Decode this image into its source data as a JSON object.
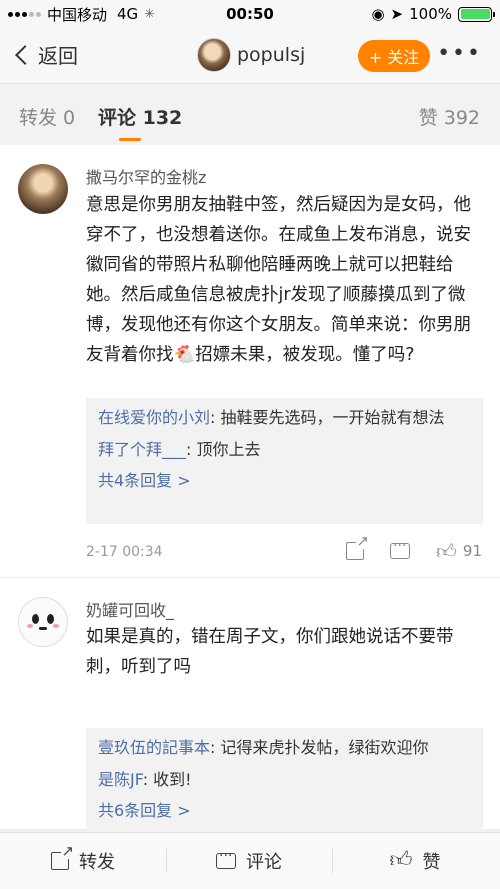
{
  "status": {
    "carrier": "中国移动",
    "network": "4G",
    "time": "00:50",
    "battery": "100%",
    "battery_level": 1.0
  },
  "nav": {
    "back_label": "返回",
    "username": "populsj",
    "follow_label": "+ 关注",
    "more": "•••"
  },
  "tabs": {
    "repost": "转发 0",
    "comments": "评论 132",
    "likes": "赞 392"
  },
  "comments": [
    {
      "user": "撒马尔罕的金桃z",
      "text": "意思是你男朋友抽鞋中签，然后疑因为是女码，他穿不了，也没想着送你。在咸鱼上发布消息，说安徽同省的带照片私聊他陪睡两晚上就可以把鞋给她。然后咸鱼信息被虎扑jr发现了顺藤摸瓜到了微博，发现他还有你这个女朋友。简单来说：你男朋友背着你找🐔招嫖未果，被发现。懂了吗?",
      "replies": [
        {
          "user": "在线爱你的小刘",
          "text": ": 抽鞋要先选码，一开始就有想法"
        },
        {
          "user": "拜了个拜___",
          "text": ": 顶你上去"
        }
      ],
      "more_replies": "共4条回复 >",
      "time": "2-17 00:34",
      "likes": "91"
    },
    {
      "user": "奶罐可回收_",
      "text": "如果是真的，错在周子文，你们跟她说话不要带刺，听到了吗",
      "replies": [
        {
          "user": "壹玖伍的記事本",
          "text": ": 记得来虎扑发帖，绿街欢迎你"
        },
        {
          "user": "是陈JF",
          "text": ": 收到!"
        }
      ],
      "more_replies": "共6条回复 >"
    }
  ],
  "bottom_bar": {
    "repost": "转发",
    "comment": "评论",
    "like": "赞"
  }
}
